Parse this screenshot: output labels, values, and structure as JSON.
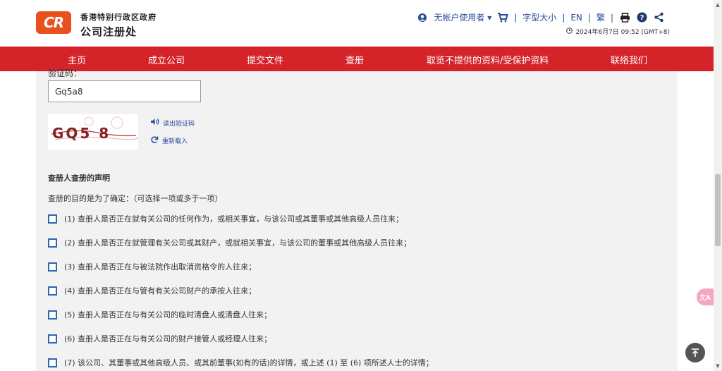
{
  "header": {
    "logo_text": "CR",
    "org_line1": "香港特别行政区政府",
    "org_line2": "公司注册处",
    "user_label": "无帐户使用者",
    "font_size_label": "字型大小",
    "lang_en": "EN",
    "lang_trad": "繁",
    "sep": "|",
    "datetime": "2024年6月7日 09:52 (GMT+8)"
  },
  "nav": {
    "items": [
      "主页",
      "成立公司",
      "提交文件",
      "查册",
      "取览不提供的资料/受保护资料",
      "联络我们"
    ]
  },
  "form": {
    "captcha_label": "验证码：",
    "captcha_value": "Gq5a8",
    "captcha_image_text": "GQ5 8",
    "read_captcha": "读出验证码",
    "reload_captcha": "重新载入",
    "section_title": "查册人查册的声明",
    "intro": "查册的目的是为了确定：（可选择一项或多于一项）",
    "options": [
      "(1) 查册人是否正在就有关公司的任何作为，或相关事宜，与该公司或其董事或其他高级人员往来；",
      "(2) 查册人是否正在就管理有关公司或其财产，或就相关事宜，与该公司的董事或其他高级人员往来；",
      "(3) 查册人是否正在与被法院作出取消资格令的人往来；",
      "(4) 查册人是否正在与管有有关公司财产的承按人往来；",
      "(5) 查册人是否正在与有关公司的临时清盘人或清盘人往来；",
      "(6) 查册人是否正在与有关公司的财产接管人或经理人往来；",
      "(7) 该公司、其董事或其他高级人员、或其前董事(如有的话)的详情，或上述 (1) 至 (6) 项所述人士的详情；"
    ]
  },
  "colors": {
    "brand_red": "#d4242a",
    "logo_orange": "#e8501e",
    "link_blue": "#2a4a9b"
  },
  "icons": {
    "translate": "文A",
    "back_to_top": "arrow-up-icon"
  }
}
